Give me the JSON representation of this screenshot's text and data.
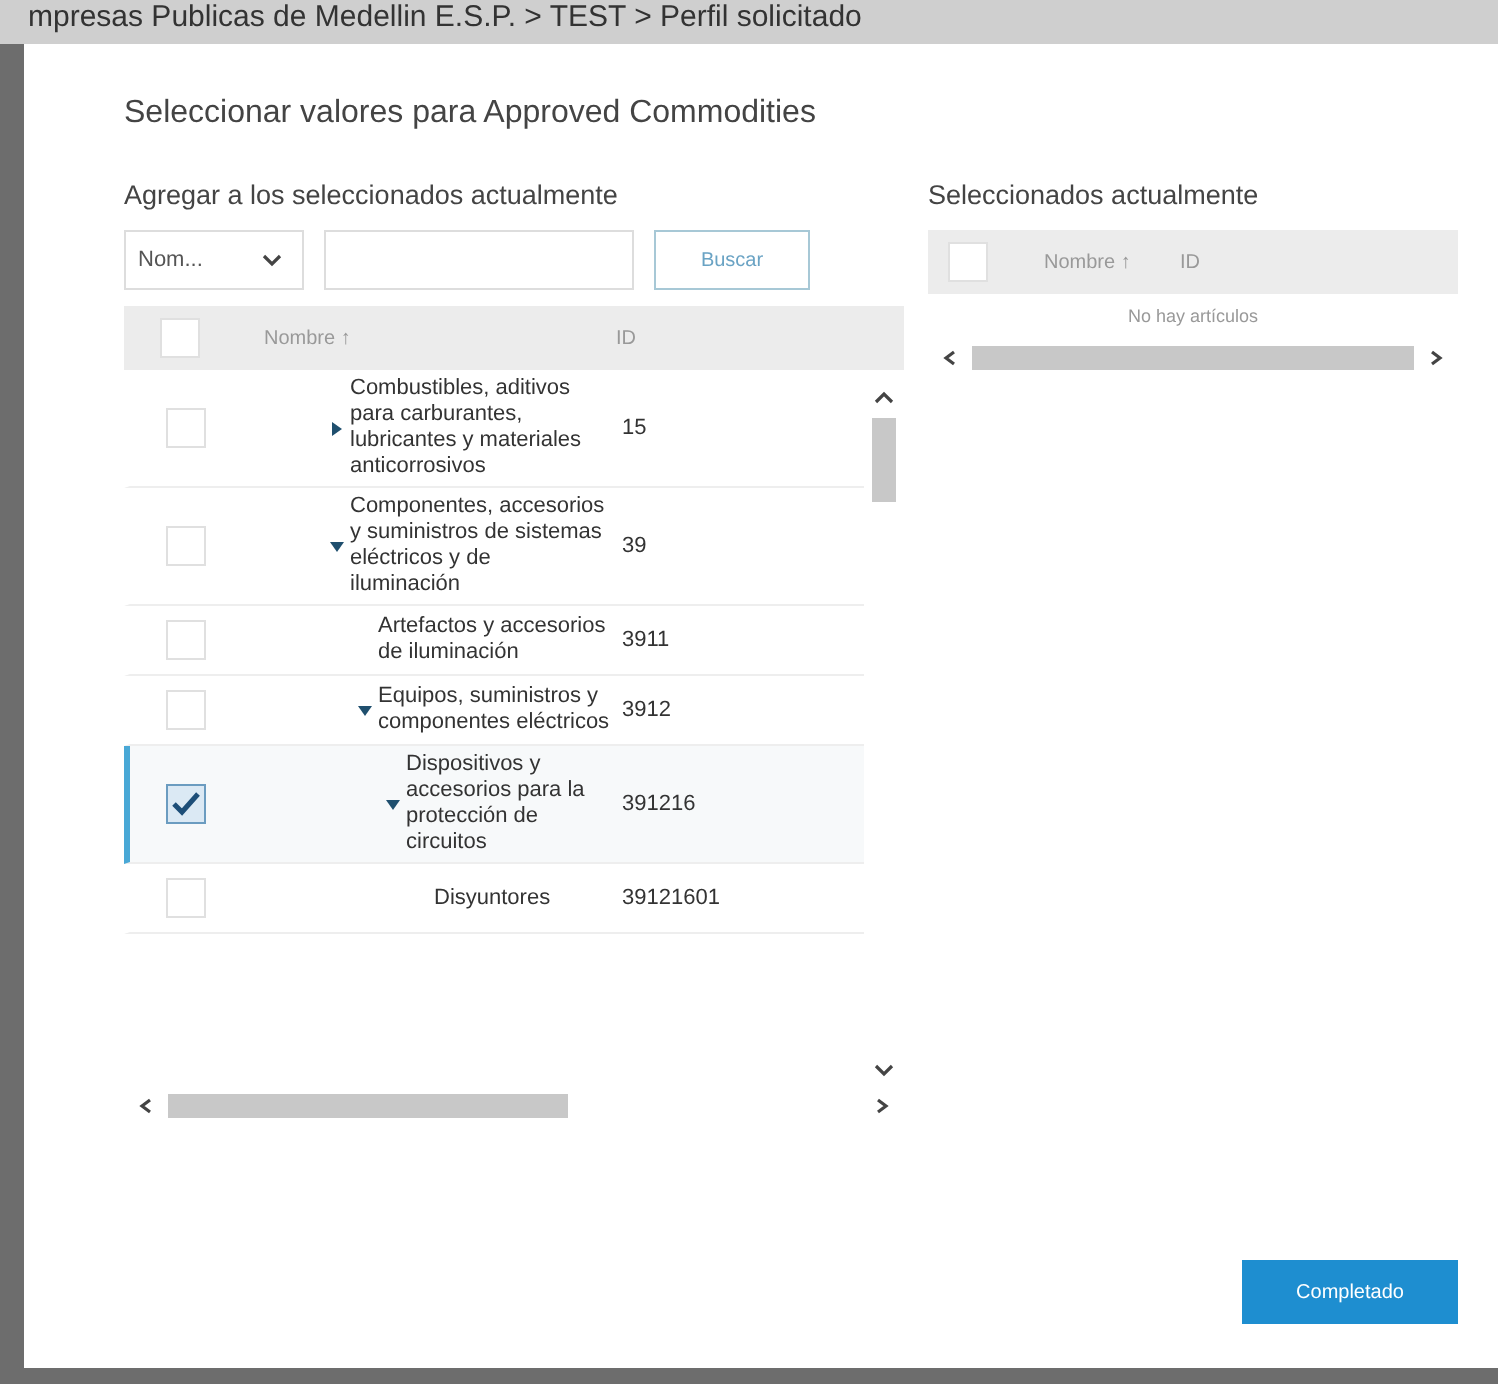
{
  "breadcrumb": "mpresas Publicas de Medellin E.S.P. > TEST > Perfil solicitado",
  "dialog": {
    "title": "Seleccionar valores para Approved Commodities",
    "left": {
      "heading": "Agregar a los seleccionados actualmente",
      "filter": "Nom...",
      "search_button": "Buscar",
      "columns": [
        "Nombre ↑",
        "ID"
      ],
      "header_checked": false,
      "rows": [
        {
          "name": "Combustibles, aditivos para carburantes, lubricantes y materiales anticorrosivos",
          "id": "15",
          "checked": false,
          "selected": false,
          "expanded": false
        },
        {
          "name": "Componentes, accesorios y suministros de sistemas eléctricos y de iluminación",
          "id": "39",
          "checked": false,
          "selected": false,
          "expanded": true,
          "children": [
            {
              "name": "Artefactos y accesorios de iluminación",
              "id": "3911",
              "checked": false,
              "selected": false
            },
            {
              "name": "Equipos, suministros y componentes eléctricos",
              "id": "3912",
              "checked": false,
              "selected": false,
              "expanded": true,
              "children": [
                {
                  "name": "Dispositivos y accesorios para la protección de circuitos",
                  "id": "391216",
                  "checked": true,
                  "selected": true,
                  "expanded": true,
                  "children": [
                    {
                      "name": "Disyuntores",
                      "id": "39121601",
                      "checked": false,
                      "selected": false
                    }
                  ]
                }
              ]
            }
          ]
        }
      ]
    },
    "right": {
      "heading": "Seleccionados actualmente",
      "columns": [
        "Nombre ↑",
        "ID"
      ],
      "header_checked": false,
      "empty_text": "No hay artículos"
    },
    "done_button": "Completado"
  }
}
